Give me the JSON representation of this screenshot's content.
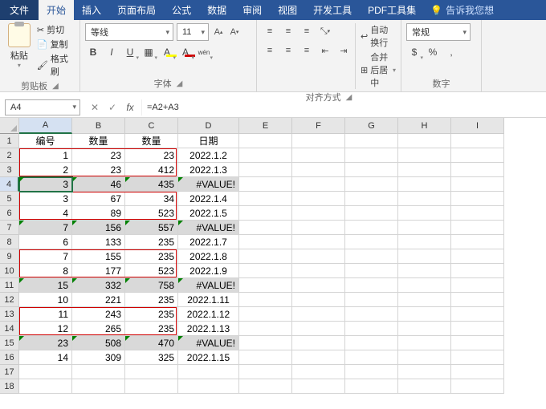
{
  "tabs": {
    "file": "文件",
    "home": "开始",
    "insert": "插入",
    "layout": "页面布局",
    "formulas": "公式",
    "data": "数据",
    "review": "审阅",
    "view": "视图",
    "dev": "开发工具",
    "pdf": "PDF工具集",
    "tell": "告诉我您想"
  },
  "clipboard": {
    "paste": "粘贴",
    "cut": "剪切",
    "copy": "复制",
    "format": "格式刷",
    "label": "剪贴板"
  },
  "font": {
    "name": "等线",
    "size": "11",
    "label": "字体"
  },
  "align": {
    "wrap": "自动换行",
    "merge": "合并后居中",
    "label": "对齐方式"
  },
  "number": {
    "format": "常规",
    "label": "数字"
  },
  "namebox": "A4",
  "formula": "=A2+A3",
  "cols": [
    "A",
    "B",
    "C",
    "D",
    "E",
    "F",
    "G",
    "H",
    "I"
  ],
  "headers": [
    "编号",
    "数量",
    "数量",
    "日期"
  ],
  "rows": [
    {
      "a": "1",
      "b": "23",
      "c": "23",
      "d": "2022.1.2"
    },
    {
      "a": "2",
      "b": "23",
      "c": "412",
      "d": "2022.1.3"
    },
    {
      "a": "3",
      "b": "46",
      "c": "435",
      "d": "#VALUE!",
      "gray": true,
      "err": true
    },
    {
      "a": "3",
      "b": "67",
      "c": "34",
      "d": "2022.1.4"
    },
    {
      "a": "4",
      "b": "89",
      "c": "523",
      "d": "2022.1.5"
    },
    {
      "a": "7",
      "b": "156",
      "c": "557",
      "d": "#VALUE!",
      "gray": true,
      "err": true
    },
    {
      "a": "6",
      "b": "133",
      "c": "235",
      "d": "2022.1.7"
    },
    {
      "a": "7",
      "b": "155",
      "c": "235",
      "d": "2022.1.8"
    },
    {
      "a": "8",
      "b": "177",
      "c": "523",
      "d": "2022.1.9"
    },
    {
      "a": "15",
      "b": "332",
      "c": "758",
      "d": "#VALUE!",
      "gray": true,
      "err": true
    },
    {
      "a": "10",
      "b": "221",
      "c": "235",
      "d": "2022.1.11"
    },
    {
      "a": "11",
      "b": "243",
      "c": "235",
      "d": "2022.1.12"
    },
    {
      "a": "12",
      "b": "265",
      "c": "235",
      "d": "2022.1.13"
    },
    {
      "a": "23",
      "b": "508",
      "c": "470",
      "d": "#VALUE!",
      "gray": true,
      "err": true
    },
    {
      "a": "14",
      "b": "309",
      "c": "325",
      "d": "2022.1.15"
    }
  ],
  "active_row": 4,
  "active_col": "A",
  "redboxes": [
    {
      "r1": 2,
      "r2": 3
    },
    {
      "r1": 5,
      "r2": 6
    },
    {
      "r1": 9,
      "r2": 10
    },
    {
      "r1": 13,
      "r2": 14
    }
  ]
}
